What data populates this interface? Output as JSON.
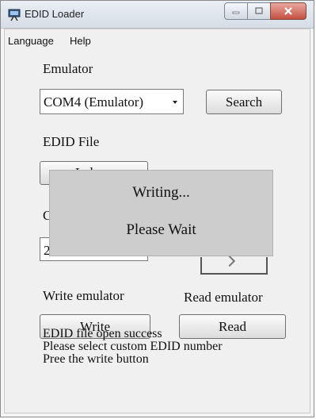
{
  "window": {
    "title": "EDID Loader"
  },
  "menu": {
    "items": [
      "Language",
      "Help"
    ]
  },
  "emulator": {
    "label": "Emulator",
    "selected": "COM4 (Emulator)",
    "search_label": "Search"
  },
  "edid_file": {
    "label": "EDID File",
    "load_label_partial": "L        d"
  },
  "custom": {
    "label_partial": "C",
    "value_partial": "2"
  },
  "write": {
    "label": "Write emulator",
    "button": "Write"
  },
  "read": {
    "label": "Read emulator",
    "button": "Read"
  },
  "status": {
    "lines": [
      "EDID file open success",
      "Please select custom EDID number",
      "Pree the write button"
    ]
  },
  "overlay": {
    "line1": "Writing...",
    "line2": "Please Wait"
  },
  "colors": {
    "overlay_bg": "#cdcdcd",
    "close_button": "#c55040"
  },
  "icons": {
    "app": "monitor-stand-icon",
    "minimize": "minimize-icon",
    "maximize": "maximize-icon",
    "close": "close-icon",
    "dropdown": "chevron-down-icon"
  }
}
